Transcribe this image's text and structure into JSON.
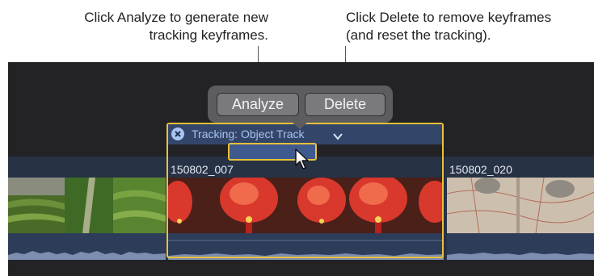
{
  "callouts": {
    "left_line1": "Click Analyze to generate new",
    "left_line2": "tracking keyframes.",
    "right_line1": "Click Delete to remove keyframes",
    "right_line2": "(and reset the tracking)."
  },
  "popup": {
    "analyze_label": "Analyze",
    "delete_label": "Delete"
  },
  "tracking": {
    "title": "Tracking: Object Track",
    "close_icon": "close-circle-icon",
    "chevron_icon": "chevron-down-icon"
  },
  "clips": {
    "first_name": "150802_007",
    "second_name": "150802_020"
  },
  "colors": {
    "accent_yellow": "#e9c13b",
    "popup_gray": "#5d5d60",
    "track_blue": "#33466a",
    "timeline_bg": "#232325"
  }
}
